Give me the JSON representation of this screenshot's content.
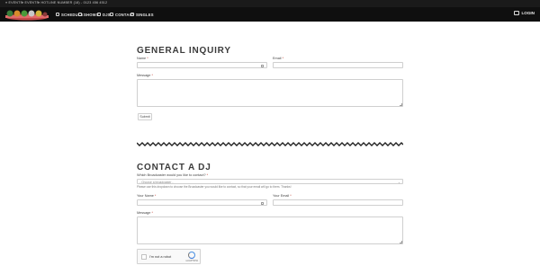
{
  "topbar": {
    "items": [
      "≡ EVENTS",
      "≡ EVENTS",
      "≡ HOTLINE NUMBER (18) - 0123 456 4512"
    ]
  },
  "nav": {
    "items": [
      {
        "label": "SCHEDULE",
        "icon": "calendar-icon"
      },
      {
        "label": "SHOWS",
        "icon": "grid-icon"
      },
      {
        "label": "DJS",
        "icon": "user-icon"
      },
      {
        "label": "CONTACT",
        "icon": "mail-icon"
      },
      {
        "label": "SINGLES",
        "icon": "music-icon"
      }
    ],
    "login": {
      "label": "LOGIN",
      "icon": "login-icon"
    }
  },
  "general": {
    "title": "GENERAL INQUIRY",
    "name_label": "Name",
    "email_label": "Email",
    "message_label": "Message",
    "submit": "Submit"
  },
  "contact": {
    "title": "CONTACT A DJ",
    "select_label": "Which Broadcaster would you like to contact?",
    "select_placeholder": "- Choose a broadcaster -",
    "help": "Please use this dropdown to choose the Broadcaster you would like to contact, so that your email will go to them. Thanks!",
    "name_label": "Your Name",
    "email_label": "Your Email",
    "message_label": "Message",
    "captcha_text": "I'm not a robot",
    "captcha_small": "reCAPTCHA"
  },
  "colors": {
    "topbar_bg": "#1a1a1a",
    "navbar_bg": "#0f0f0f",
    "required": "#c0392b",
    "heading": "#3b3b3b"
  }
}
